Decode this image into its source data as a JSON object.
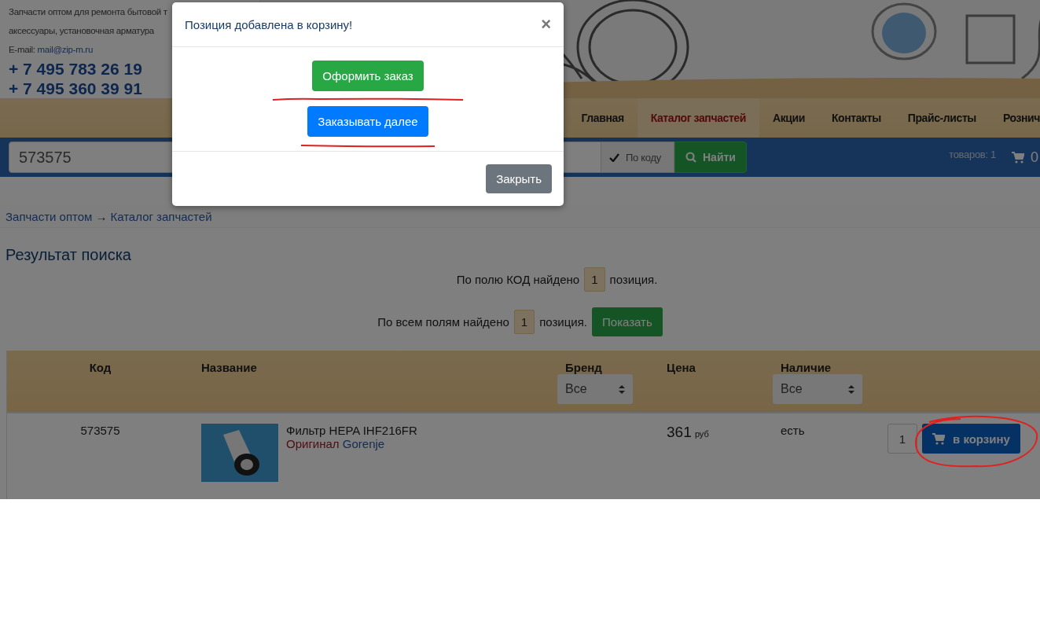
{
  "header": {
    "tagline_lines": [
      "Запчасти оптом для ремонта бытовой т",
      "аксессуары, установочная арматура"
    ],
    "email_label": "E-mail:",
    "email": "mail@zip-m.ru",
    "phones": [
      "+ 7 495 783 26 19",
      "+ 7 495 360 39 91"
    ]
  },
  "nav": [
    {
      "label": "Главная",
      "selected": false
    },
    {
      "label": "Каталог запчастей",
      "selected": true
    },
    {
      "label": "Акции",
      "selected": false
    },
    {
      "label": "Контакты",
      "selected": false
    },
    {
      "label": "Прайс-листы",
      "selected": false
    },
    {
      "label": "Рознич",
      "selected": false
    }
  ],
  "search": {
    "value": "573575",
    "by_code": {
      "label": "По коду",
      "checked": true
    },
    "button": "Найти",
    "cart_count": "товаров: 1",
    "cart_total": "0"
  },
  "breadcrumb": {
    "items": [
      "Запчасти оптом",
      "Каталог запчастей"
    ],
    "separator": "→"
  },
  "title": "Результат поиска",
  "found": [
    {
      "prefix": "По полю КОД найдено",
      "count": "1",
      "suffix": "позиция."
    },
    {
      "prefix": "По всем полям найдено",
      "count": "1",
      "suffix": "позиция.",
      "button": "Показать"
    }
  ],
  "table": {
    "columns": [
      {
        "label": "Код"
      },
      {
        "label": "Название"
      },
      {
        "label": "Бренд",
        "filter": "Все"
      },
      {
        "label": "Цена"
      },
      {
        "label": "Наличие",
        "filter": "Все"
      }
    ],
    "rows": [
      {
        "code": "573575",
        "name": "Фильтр HEPA IHF216FR",
        "quality": "Оригинал",
        "brand": "Gorenje",
        "price": "361",
        "currency": "руб",
        "stock": "есть",
        "quantity": "1",
        "button": "в корзину"
      }
    ]
  },
  "modal": {
    "title": "Позиция добавлена в корзину!",
    "close": "×",
    "actions": [
      {
        "label": "Оформить заказ",
        "kind": "success"
      },
      {
        "label": "Заказывать далее",
        "kind": "primary"
      }
    ],
    "footer_button": "Закрыть"
  }
}
